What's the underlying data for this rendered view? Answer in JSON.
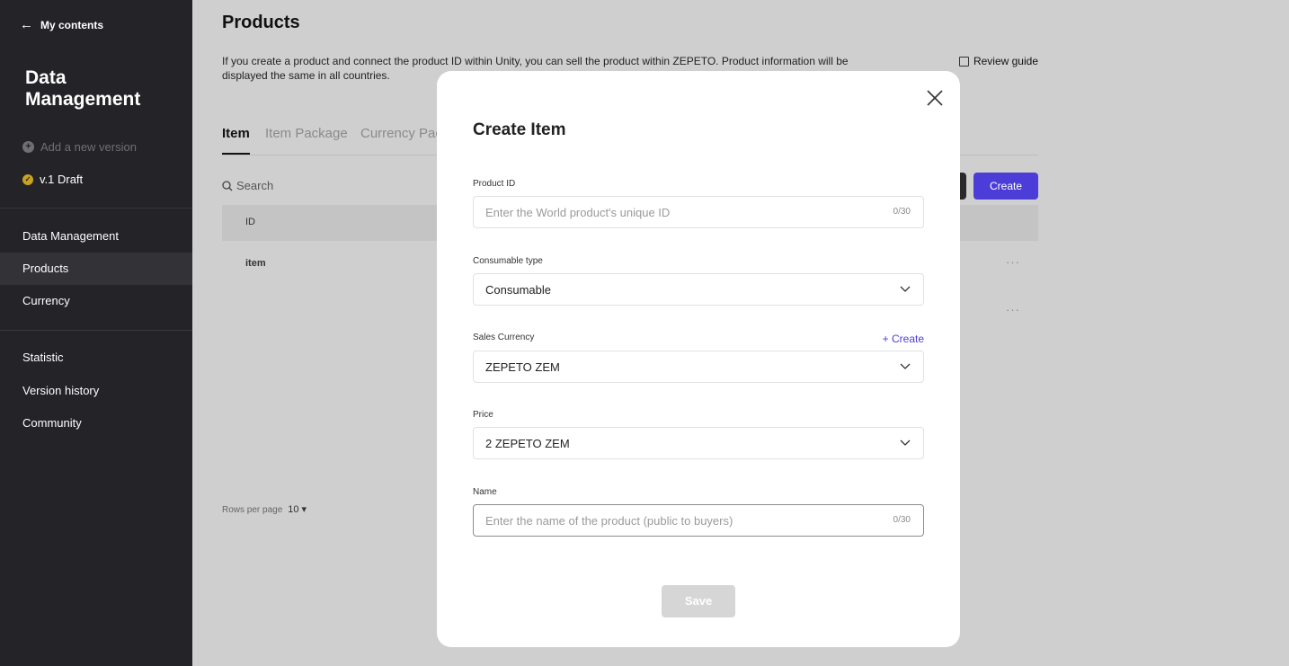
{
  "sidebar": {
    "back_label": "My contents",
    "title": "Data Management",
    "add_version": "Add a new version",
    "draft": "v.1 Draft",
    "nav": [
      "Data Management",
      "Products",
      "Currency"
    ],
    "nav2": [
      "Statistic",
      "Version history",
      "Community"
    ],
    "active": "Products"
  },
  "main": {
    "title": "Products",
    "description": "If you create a product and connect the product ID within Unity, you can sell the product within ZEPETO. Product information will be displayed the same in all countries.",
    "review_guide": "Review guide",
    "tabs": [
      "Item",
      "Item Package",
      "Currency Pac"
    ],
    "search_placeholder": "Search",
    "create_button": "Create",
    "table": {
      "header_id": "ID",
      "rows": [
        {
          "id": "item"
        }
      ]
    },
    "rows_per_page_label": "Rows per page",
    "rows_per_page_value": "10 ▾"
  },
  "modal": {
    "title": "Create Item",
    "product_id": {
      "label": "Product ID",
      "placeholder": "Enter the World product's unique ID",
      "counter": "0/30"
    },
    "consumable_type": {
      "label": "Consumable type",
      "value": "Consumable"
    },
    "sales_currency": {
      "label": "Sales Currency",
      "value": "ZEPETO ZEM",
      "create_link": "+ Create"
    },
    "price": {
      "label": "Price",
      "value": "2 ZEPETO ZEM"
    },
    "name": {
      "label": "Name",
      "placeholder": "Enter the name of the product (public to buyers)",
      "counter": "0/30"
    },
    "save_button": "Save"
  },
  "colors": {
    "sidebar_bg": "#232328",
    "accent": "#4c3dd8",
    "overlay": "#cfcfcf",
    "draft_badge": "#c9a31f"
  },
  "icons": [
    "arrow-left-icon",
    "plus-circle-icon",
    "check-circle-icon",
    "document-icon",
    "search-icon",
    "close-icon",
    "chevron-down-icon",
    "more-icon"
  ]
}
